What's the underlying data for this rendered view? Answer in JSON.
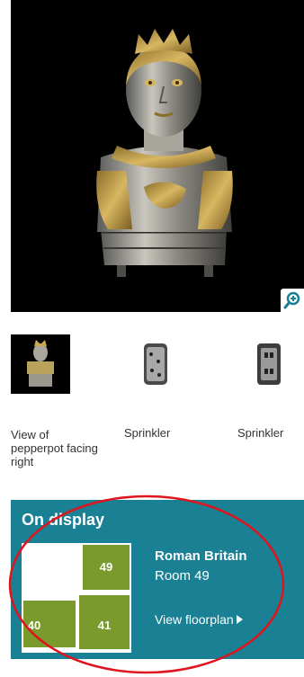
{
  "main_image": {
    "zoom_icon": "magnifier-zoom-icon"
  },
  "thumbnails": [
    {
      "caption": "View of pepperpot facing right"
    },
    {
      "caption": "Sprinkler"
    },
    {
      "caption": "Sprinkler"
    }
  ],
  "on_display": {
    "title": "On display",
    "room_name": "Roman Britain",
    "room_number": "Room 49",
    "floorplan_link": "View floorplan",
    "floorplan": {
      "rooms": [
        "49",
        "40",
        "41"
      ]
    }
  },
  "colors": {
    "panel_bg": "#1a8094",
    "room_green": "#7a9a2e",
    "annotation_red": "#e0141e"
  }
}
